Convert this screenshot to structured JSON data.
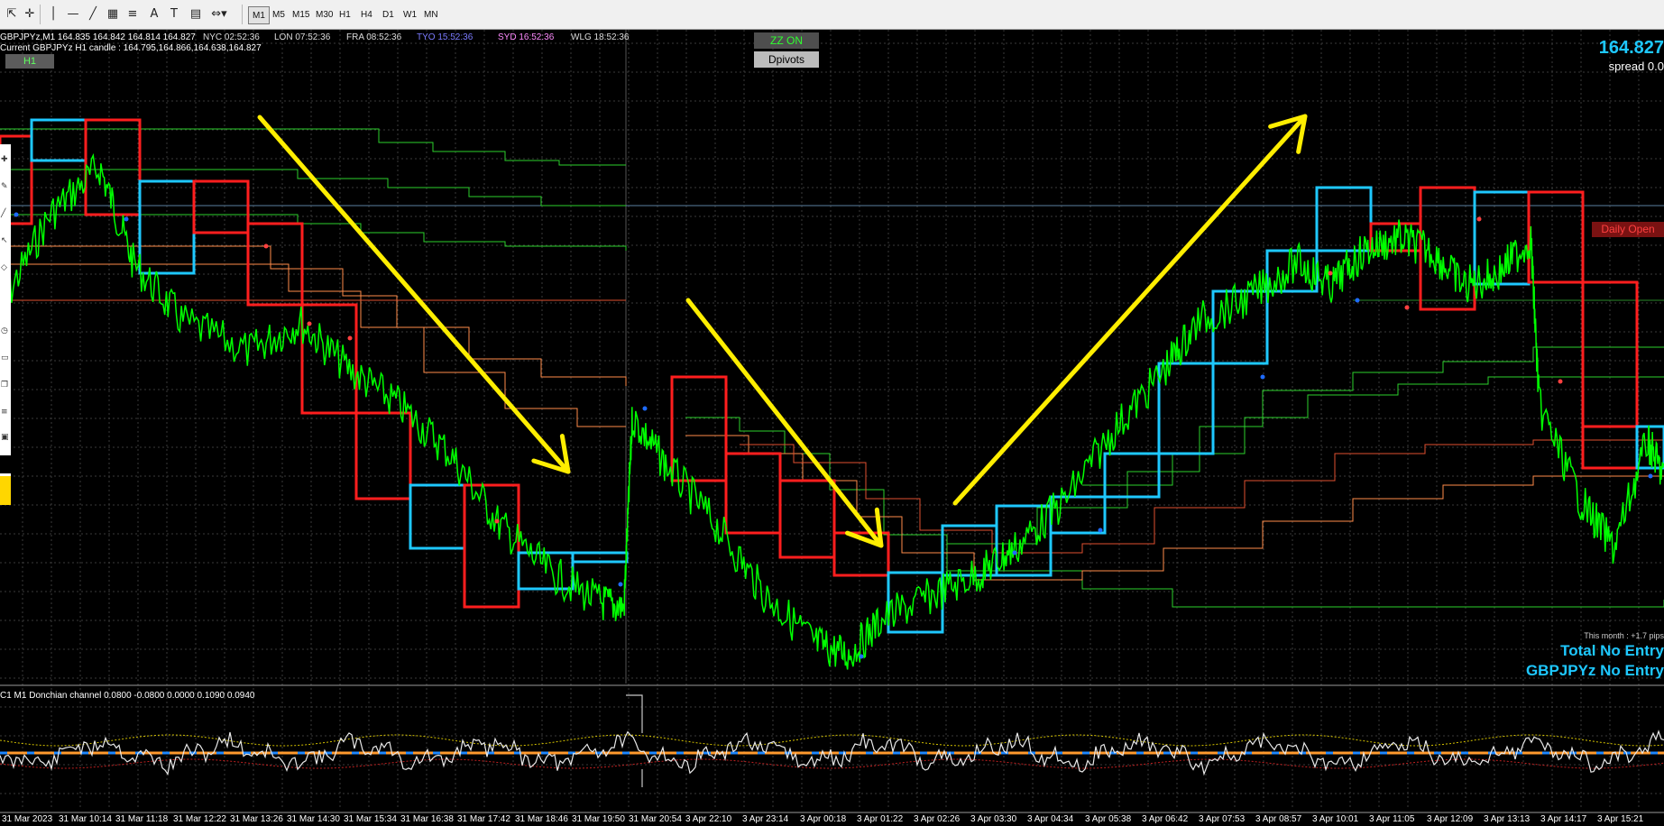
{
  "toolbar": {
    "tools": [
      "cursor-icon",
      "crosshair-icon",
      "vertical-line-icon",
      "horizontal-line-icon",
      "trendline-icon",
      "channel-icon",
      "fibonacci-icon",
      "text-icon",
      "text-label-icon",
      "gann-icon",
      "arrows-icon"
    ],
    "timeframes": [
      "M1",
      "M5",
      "M15",
      "M30",
      "H1",
      "H4",
      "D1",
      "W1",
      "MN"
    ],
    "active_timeframe": "M1"
  },
  "header": {
    "symbol_line": "GBPJPYz,M1  164.835 164.842 164.814 164.827",
    "candle_line": "Current GBPJPYz H1 candle : 164.795,164.866,164.638,164.827",
    "h1_label": "H1"
  },
  "sessions": [
    {
      "label": "NYC 02:52:36",
      "color": "#dddddd"
    },
    {
      "label": "LON 07:52:36",
      "color": "#dddddd"
    },
    {
      "label": "FRA 08:52:36",
      "color": "#dddddd"
    },
    {
      "label": "TYO 15:52:36",
      "color": "#7b7bff"
    },
    {
      "label": "SYD 16:52:36",
      "color": "#ff8cff"
    },
    {
      "label": "WLG 18:52:36",
      "color": "#dddddd"
    }
  ],
  "buttons": {
    "zz_on": "ZZ ON",
    "dpivots": "Dpivots"
  },
  "right_panel": {
    "price": "164.827",
    "spread": "spread 0.0",
    "daily_open": "Daily Open",
    "month": "This month : +1.7 pips",
    "total": "Total No Entry",
    "symbol_status": "GBPJPYz No Entry"
  },
  "indicator": {
    "label": "C1 M1 Donchian channel 0.0800 -0.0800 0.0000 0.1090 0.0940"
  },
  "time_axis": [
    "31 Mar 2023",
    "31 Mar 10:14",
    "31 Mar 11:18",
    "31 Mar 12:22",
    "31 Mar 13:26",
    "31 Mar 14:30",
    "31 Mar 15:34",
    "31 Mar 16:38",
    "31 Mar 17:42",
    "31 Mar 18:46",
    "31 Mar 19:50",
    "31 Mar 20:54",
    "3 Apr 22:10",
    "3 Apr 23:14",
    "3 Apr 00:18",
    "3 Apr 01:22",
    "3 Apr 02:26",
    "3 Apr 03:30",
    "3 Apr 04:34",
    "3 Apr 05:38",
    "3 Apr 06:42",
    "3 Apr 07:53",
    "3 Apr 08:57",
    "3 Apr 10:01",
    "3 Apr 11:05",
    "3 Apr 12:09",
    "3 Apr 13:13",
    "3 Apr 14:17",
    "3 Apr 15:21"
  ],
  "colors": {
    "price_line": "#00ff00",
    "bullish_box": "#1ec8ff",
    "bearish_box": "#ff1e1e",
    "arrow": "#ffee00",
    "grid": "#3a3a3a",
    "accent": "#1ec8ff"
  },
  "chart_data": {
    "type": "line",
    "price_path": [
      [
        0,
        0.62
      ],
      [
        0.03,
        0.78
      ],
      [
        0.06,
        0.86
      ],
      [
        0.08,
        0.7
      ],
      [
        0.11,
        0.6
      ],
      [
        0.15,
        0.55
      ],
      [
        0.18,
        0.6
      ],
      [
        0.21,
        0.52
      ],
      [
        0.24,
        0.46
      ],
      [
        0.27,
        0.38
      ],
      [
        0.3,
        0.26
      ],
      [
        0.33,
        0.18
      ],
      [
        0.36,
        0.13
      ],
      [
        0.375,
        0.12
      ],
      [
        0.38,
        0.44
      ],
      [
        0.4,
        0.36
      ],
      [
        0.43,
        0.26
      ],
      [
        0.46,
        0.14
      ],
      [
        0.49,
        0.06
      ],
      [
        0.51,
        0.04
      ],
      [
        0.53,
        0.1
      ],
      [
        0.56,
        0.14
      ],
      [
        0.59,
        0.18
      ],
      [
        0.61,
        0.22
      ],
      [
        0.64,
        0.3
      ],
      [
        0.67,
        0.42
      ],
      [
        0.7,
        0.52
      ],
      [
        0.72,
        0.6
      ],
      [
        0.75,
        0.64
      ],
      [
        0.78,
        0.7
      ],
      [
        0.8,
        0.66
      ],
      [
        0.82,
        0.72
      ],
      [
        0.84,
        0.74
      ],
      [
        0.86,
        0.72
      ],
      [
        0.88,
        0.66
      ],
      [
        0.9,
        0.68
      ],
      [
        0.92,
        0.74
      ],
      [
        0.925,
        0.46
      ],
      [
        0.95,
        0.3
      ],
      [
        0.97,
        0.22
      ],
      [
        0.99,
        0.4
      ],
      [
        1.0,
        0.34
      ]
    ]
  }
}
